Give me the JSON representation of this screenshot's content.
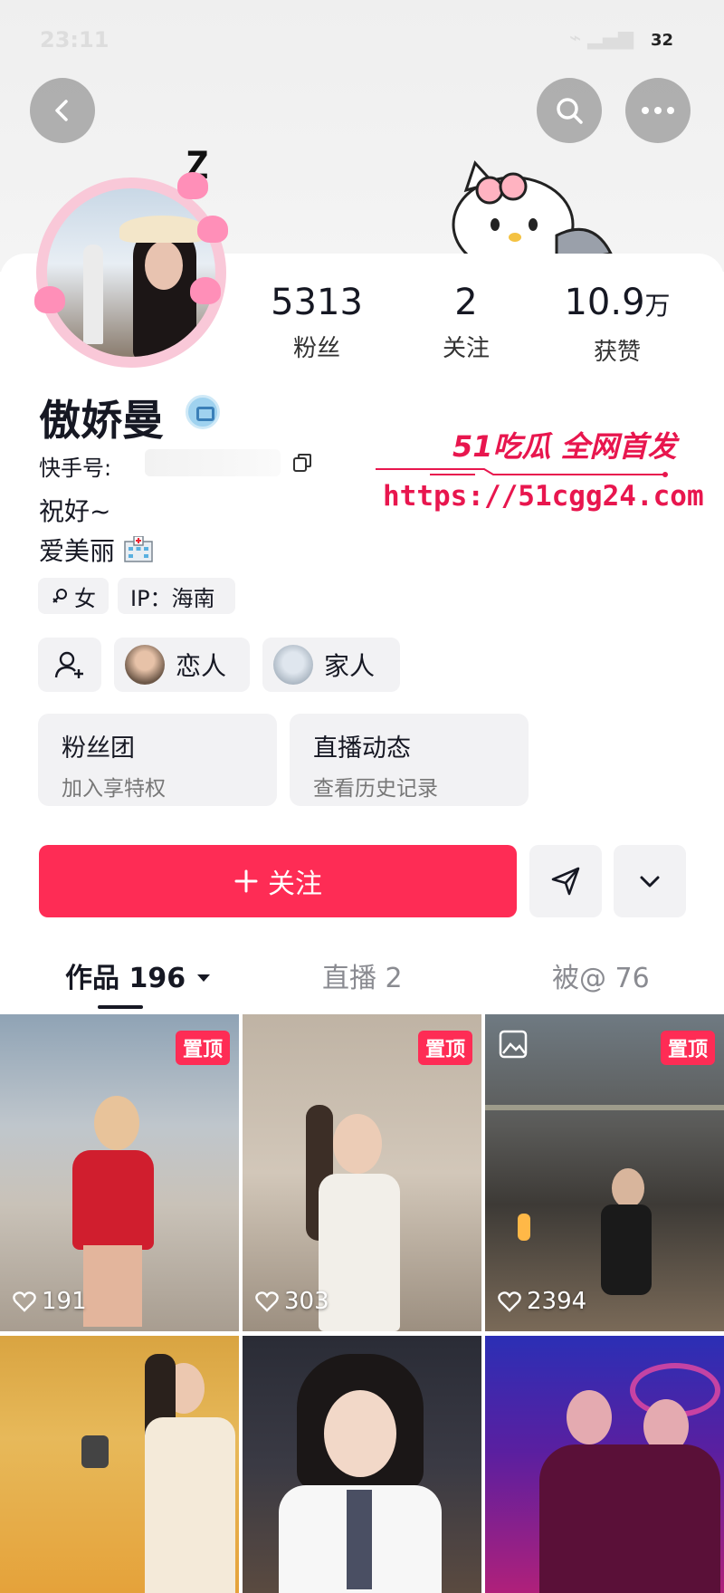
{
  "status_bar": {
    "time": "23:11",
    "battery": "32"
  },
  "header": {
    "sticker_text": "Z"
  },
  "profile": {
    "nickname": "傲娇曼",
    "account_label": "快手号:",
    "bio_lines": [
      "祝好~",
      "爱美丽"
    ],
    "gender_tag": "女",
    "ip_tag": "IP：海南"
  },
  "stats": [
    {
      "value": "5313",
      "unit": "",
      "label": "粉丝"
    },
    {
      "value": "2",
      "unit": "",
      "label": "关注"
    },
    {
      "value": "10.9",
      "unit": "万",
      "label": "获赞"
    }
  ],
  "relations": [
    {
      "label": "恋人"
    },
    {
      "label": "家人"
    }
  ],
  "cards": [
    {
      "title": "粉丝团",
      "subtitle": "加入享特权"
    },
    {
      "title": "直播动态",
      "subtitle": "查看历史记录"
    }
  ],
  "actions": {
    "follow_label": "关注"
  },
  "tabs": [
    {
      "label": "作品 196",
      "active": true
    },
    {
      "label": "直播 2",
      "active": false
    },
    {
      "label": "被@ 76",
      "active": false
    }
  ],
  "watermark": {
    "brand": "51吃瓜 全网首发",
    "url": "https://51cgg24.com"
  },
  "posts": [
    {
      "likes": "191",
      "pinned": true,
      "pin_label": "置顶"
    },
    {
      "likes": "303",
      "pinned": true,
      "pin_label": "置顶"
    },
    {
      "likes": "2394",
      "pinned": true,
      "pin_label": "置顶"
    },
    {
      "likes": "",
      "pinned": false
    },
    {
      "likes": "",
      "pinned": false
    },
    {
      "likes": "",
      "pinned": false
    }
  ],
  "colors": {
    "accent": "#fe2c55",
    "watermark": "#e8164e",
    "chip_bg": "#f2f2f4"
  }
}
